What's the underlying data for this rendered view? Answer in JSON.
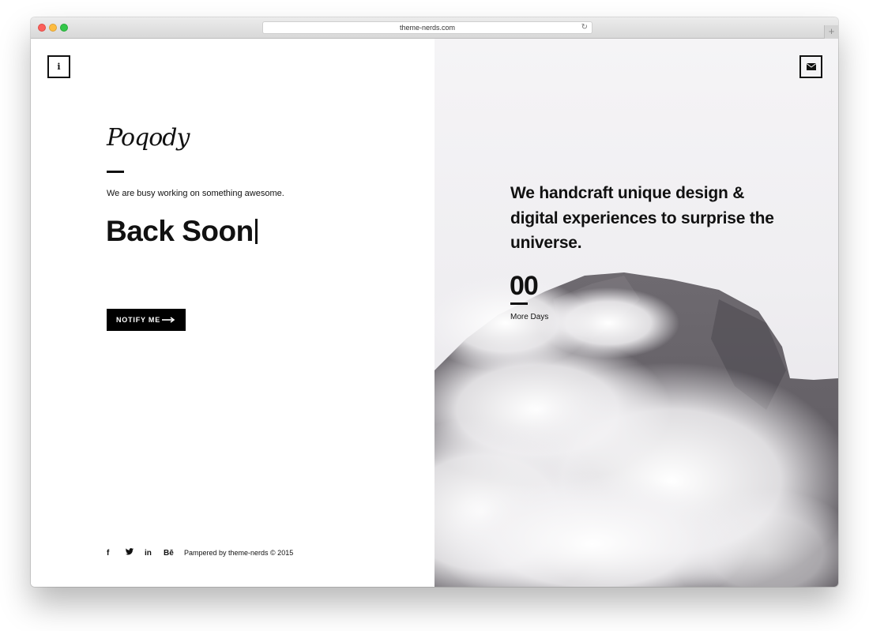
{
  "browser": {
    "url": "theme-nerds.com",
    "reload_icon": "reload-icon",
    "new_tab_icon": "plus-icon"
  },
  "left_panel": {
    "info_icon": "info-icon",
    "logo_text": "Poqody",
    "tagline": "We are busy working on something awesome.",
    "headline": "Back Soon",
    "notify_label": "NOTIFY ME",
    "social": [
      {
        "name": "facebook-icon",
        "glyph": "f"
      },
      {
        "name": "twitter-icon",
        "glyph": "🐦"
      },
      {
        "name": "linkedin-icon",
        "glyph": "in"
      },
      {
        "name": "behance-icon",
        "glyph": "Bē"
      }
    ],
    "copyright": "Pampered by theme-nerds © 2015"
  },
  "right_panel": {
    "mail_icon": "envelope-icon",
    "statement": "We handcraft unique design & digital experiences to surprise the universe.",
    "counter_value": "00",
    "counter_label": "More Days"
  },
  "colors": {
    "text": "#111111",
    "button_bg": "#000000",
    "accent": "#111111"
  }
}
